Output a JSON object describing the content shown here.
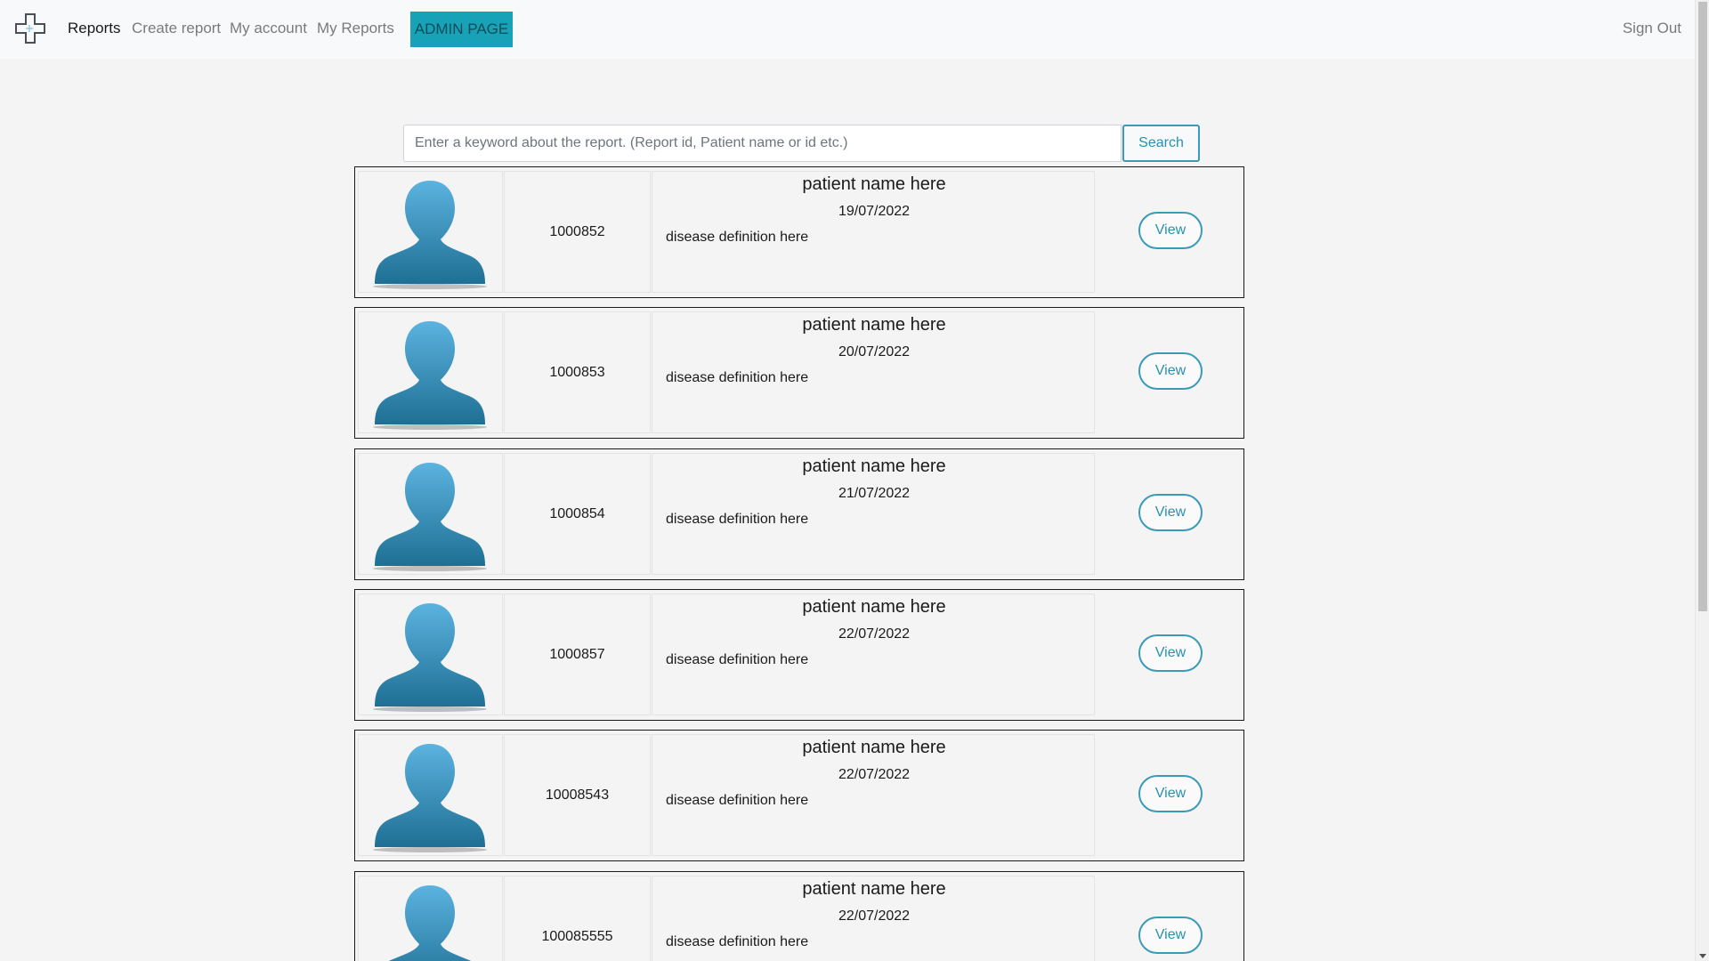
{
  "nav": {
    "items": [
      {
        "label": "Reports",
        "active": true
      },
      {
        "label": "Create report",
        "active": false
      },
      {
        "label": "My account",
        "active": false
      },
      {
        "label": "My Reports",
        "active": false
      }
    ],
    "admin_label": "ADMIN PAGE",
    "signout_label": "Sign Out",
    "brand_icon": "medical-cross-icon"
  },
  "search": {
    "placeholder": "Enter a keyword about the report. (Report id, Patient name or id etc.)",
    "value": "",
    "button_label": "Search"
  },
  "colors": {
    "accent": "#17a2b8",
    "button_outline": "#3a9ab7",
    "avatar_top": "#5bb3df",
    "avatar_bottom": "#1f6f94"
  },
  "reports": [
    {
      "id": "1000852",
      "patient_name": "patient name here",
      "date": "19/07/2022",
      "disease": "disease definition here",
      "button_label": "View"
    },
    {
      "id": "1000853",
      "patient_name": "patient name here",
      "date": "20/07/2022",
      "disease": "disease definition here",
      "button_label": "View"
    },
    {
      "id": "1000854",
      "patient_name": "patient name here",
      "date": "21/07/2022",
      "disease": "disease definition here",
      "button_label": "View"
    },
    {
      "id": "1000857",
      "patient_name": "patient name here",
      "date": "22/07/2022",
      "disease": "disease definition here",
      "button_label": "View"
    },
    {
      "id": "10008543",
      "patient_name": "patient name here",
      "date": "22/07/2022",
      "disease": "disease definition here",
      "button_label": "View"
    },
    {
      "id": "100085555",
      "patient_name": "patient name here",
      "date": "22/07/2022",
      "disease": "disease definition here",
      "button_label": "View"
    }
  ]
}
